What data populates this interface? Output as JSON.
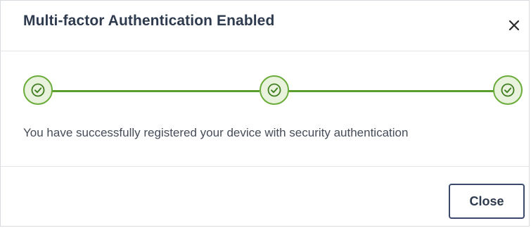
{
  "dialog": {
    "title": "Multi-factor Authentication Enabled",
    "close_icon": "close-icon",
    "steps": [
      {
        "status": "complete",
        "icon": "check-circle-icon"
      },
      {
        "status": "complete",
        "icon": "check-circle-icon"
      },
      {
        "status": "complete",
        "icon": "check-circle-icon"
      }
    ],
    "message": "You have successfully registered your device with security authentication",
    "close_button_label": "Close"
  },
  "colors": {
    "accent_green": "#5a9e2d",
    "step_fill": "#e8f2dd",
    "button_border": "#3b4a6b",
    "title_text": "#2e3a4d",
    "body_text": "#454c57"
  }
}
